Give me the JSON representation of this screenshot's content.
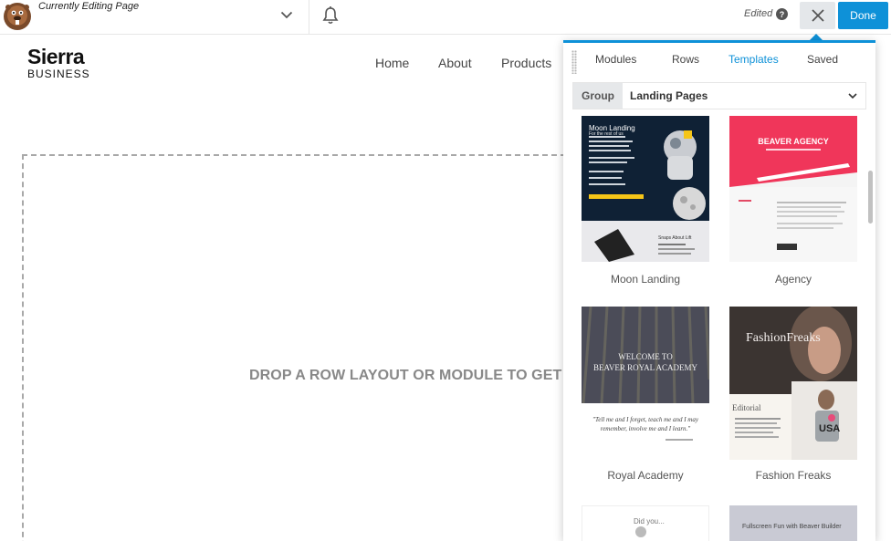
{
  "topbar": {
    "editing_title": "Currently Editing Page",
    "edited_label": "Edited",
    "help_glyph": "?",
    "done_label": "Done",
    "icons": [
      "beaver-logo-icon",
      "chevron-down-icon",
      "bell-icon",
      "help-icon",
      "close-icon"
    ]
  },
  "site": {
    "brand_main": "Sierra",
    "brand_sub": "BUSINESS",
    "nav": [
      "Home",
      "About",
      "Products"
    ]
  },
  "canvas": {
    "drop_text": "DROP A ROW LAYOUT OR MODULE TO GET"
  },
  "panel": {
    "tabs": [
      {
        "label": "Modules",
        "active": false
      },
      {
        "label": "Rows",
        "active": false
      },
      {
        "label": "Templates",
        "active": true
      },
      {
        "label": "Saved",
        "active": false
      }
    ],
    "group_label": "Group",
    "group_value": "Landing Pages",
    "templates": [
      {
        "name": "Moon Landing",
        "thumb_title": "Moon Landing",
        "thumb_subtitle": "For the rest of us",
        "thumb_note": "Snaps About Lift"
      },
      {
        "name": "Agency",
        "thumb_title": "BEAVER AGENCY"
      },
      {
        "name": "Royal Academy",
        "thumb_title_1": "WELCOME TO",
        "thumb_title_2": "BEAVER ROYAL ACADEMY",
        "thumb_quote_1": "\"Tell me and I forget, teach me and I may",
        "thumb_quote_2": "remember, involve me and I learn.\""
      },
      {
        "name": "Fashion Freaks",
        "thumb_title": "FashionFreaks",
        "thumb_heading": "Editorial",
        "thumb_shirt": "USA"
      },
      {
        "name": "",
        "thumb_text": "Did you..."
      },
      {
        "name": "",
        "thumb_text": "Fullscreen Fun with Beaver Builder"
      }
    ],
    "colors": {
      "accent": "#0e91d8",
      "agency_red": "#f0365a",
      "moon_yellow": "#f5c518"
    }
  }
}
